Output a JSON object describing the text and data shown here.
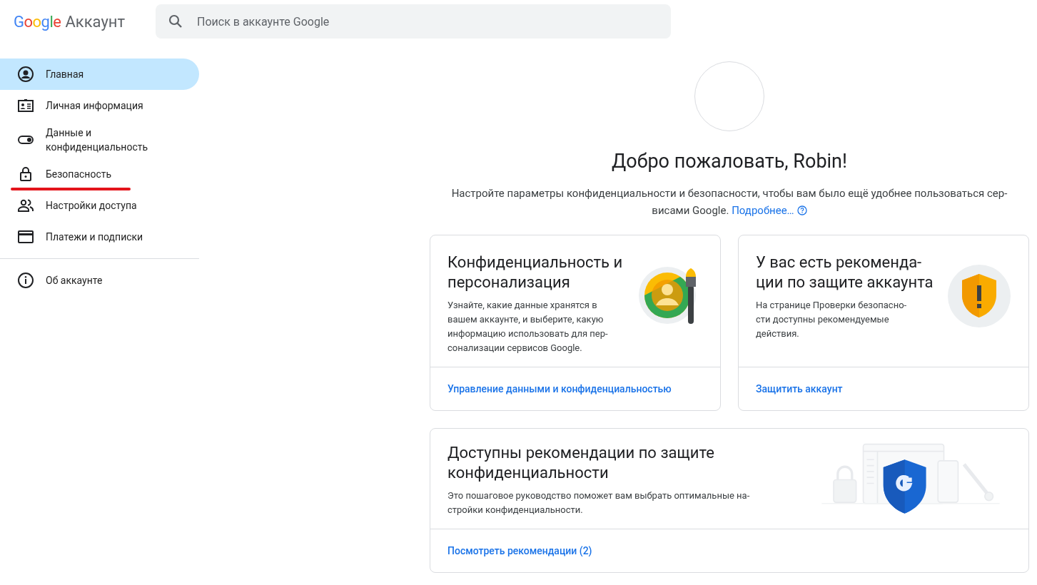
{
  "header": {
    "logo_word": "Google",
    "product": "Аккаунт",
    "search": {
      "placeholder": "Поиск в аккаунте Google"
    }
  },
  "sidebar": {
    "items": [
      {
        "kind": "home",
        "label": "Главная",
        "selected": true,
        "underlined": false
      },
      {
        "kind": "person",
        "label": "Личная информация",
        "selected": false,
        "underlined": false
      },
      {
        "kind": "toggle",
        "label": "Данные и конфиденциальность",
        "selected": false,
        "underlined": false
      },
      {
        "kind": "lock",
        "label": "Безопасность",
        "selected": false,
        "underlined": true
      },
      {
        "kind": "people",
        "label": "Настройки доступа",
        "selected": false,
        "underlined": false
      },
      {
        "kind": "card",
        "label": "Платежи и подписки",
        "selected": false,
        "underlined": false
      },
      {
        "kind": "divider"
      },
      {
        "kind": "info",
        "label": "Об аккаунте",
        "selected": false,
        "underlined": false
      }
    ]
  },
  "welcome": {
    "title": "Добро пожаловать, Robin!",
    "description_lines": [
      "Настройте параметры конфиденциальности и безопасности, чтобы вам было ещё удобнее пользоваться сер-",
      "висами Google."
    ],
    "link": "Подробнее…"
  },
  "cards": [
    {
      "kind": "privacy",
      "title_lines": [
        "Конфиденциальность и",
        "персонализация"
      ],
      "body_lines": [
        "Узнайте, какие данные хранятся в",
        "вашем аккаунте, и выберите, какую",
        "информацию использовать для пер-",
        "сонализации сервисов Google."
      ],
      "link": "Управление данными и конфиденциальностью"
    },
    {
      "kind": "security",
      "title_lines": [
        "У вас есть рекоменда-",
        "ции по защите аккаунта"
      ],
      "body_lines": [
        "На странице Проверки безопасно-",
        "сти доступны рекомендуемые",
        "действия."
      ],
      "link": "Защитить аккаунт"
    },
    {
      "kind": "checkup",
      "title_lines": [
        "Доступны рекомендации по защите",
        "конфиденциальности"
      ],
      "body_lines": [
        "Это пошаговое руководство поможет вам выбрать оптимальные на-",
        "стройки конфиденциальности."
      ],
      "link": "Посмотреть рекомендации (2)"
    }
  ]
}
